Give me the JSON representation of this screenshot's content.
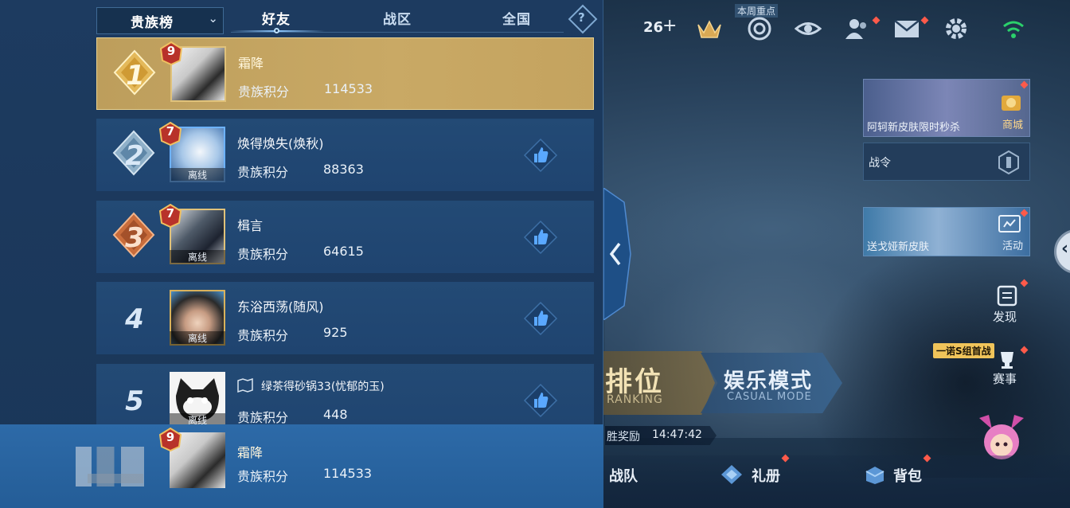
{
  "leaderboard": {
    "dropdown_label": "贵族榜",
    "tabs": [
      {
        "label": "好友",
        "active": true
      },
      {
        "label": "战区",
        "active": false
      },
      {
        "label": "全国",
        "active": false
      }
    ],
    "help_symbol": "?",
    "score_label": "贵族积分",
    "offline_label": "离线",
    "rows": [
      {
        "rank": "1",
        "vip": "9",
        "name": "霜降",
        "score": "114533",
        "offline": false,
        "highlight": true
      },
      {
        "rank": "2",
        "vip": "7",
        "name": "焕得焕失(焕秋)",
        "score": "88363",
        "offline": true
      },
      {
        "rank": "3",
        "vip": "7",
        "name": "楫言",
        "score": "64615",
        "offline": true
      },
      {
        "rank": "4",
        "vip": "",
        "name": "东浴西荡(随风)",
        "score": "925",
        "offline": true
      },
      {
        "rank": "5",
        "vip": "",
        "name": "绿茶得砂锅33(忧郁的玉)",
        "score": "448",
        "offline": true
      }
    ],
    "me": {
      "vip": "9",
      "name": "霜降",
      "score": "114533"
    }
  },
  "hud": {
    "coins": "26",
    "week_tag": "本周重点",
    "icons": [
      "crown-icon",
      "target-icon",
      "eye-icon",
      "friends-icon",
      "mail-icon",
      "gear-icon",
      "wifi-icon"
    ]
  },
  "side_cards": {
    "skin_promo": "阿轲新皮肤限时秒杀",
    "shop": "商城",
    "pass": "战令",
    "event_promo": "送戈娅新皮肤",
    "event": "活动",
    "discover": "发现",
    "match_tag": "一诺S组首战",
    "match": "赛事"
  },
  "modes": {
    "ranked_title": "排位",
    "ranked_sub": "RANKING",
    "casual_title": "娱乐模式",
    "casual_sub": "CASUAL MODE"
  },
  "timer": {
    "label": "胜奖励",
    "value": "14:47:42"
  },
  "bottom_nav": [
    {
      "label": "战队"
    },
    {
      "label": "礼册"
    },
    {
      "label": "背包"
    }
  ],
  "colors": {
    "gold_row": "#c4a35f",
    "panel": "#1a3658",
    "accent": "#5aa8ff"
  }
}
